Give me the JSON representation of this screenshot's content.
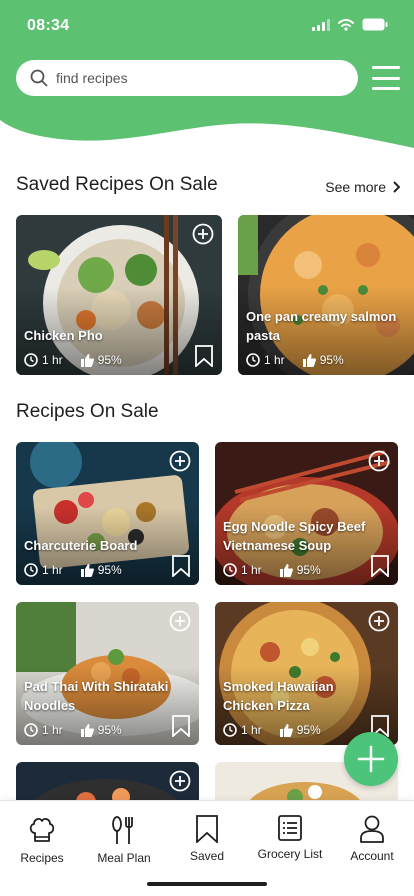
{
  "status_bar": {
    "time": "08:34"
  },
  "search": {
    "placeholder": "find recipes"
  },
  "saved_section": {
    "title": "Saved Recipes On Sale",
    "see_more": "See more"
  },
  "saved_recipes": [
    {
      "title": "Chicken Pho",
      "time": "1 hr",
      "rating": "95%"
    },
    {
      "title": "One pan creamy salmon pasta",
      "time": "1 hr",
      "rating": "95%"
    }
  ],
  "sale_section": {
    "title": "Recipes On Sale"
  },
  "sale_recipes": [
    {
      "title": "Charcuterie Board",
      "time": "1 hr",
      "rating": "95%"
    },
    {
      "title": "Egg Noodle Spicy Beef Vietnamese Soup",
      "time": "1 hr",
      "rating": "95%"
    },
    {
      "title": "Pad Thai With Shirataki Noodles",
      "time": "1 hr",
      "rating": "95%"
    },
    {
      "title": "Smoked Hawaiian Chicken Pizza",
      "time": "1 hr",
      "rating": "95%"
    }
  ],
  "nav": {
    "recipes": "Recipes",
    "meal_plan": "Meal Plan",
    "saved": "Saved",
    "grocery_list": "Grocery List",
    "account": "Account"
  },
  "colors": {
    "brand_green": "#5cc272",
    "fab_green": "#4cc47a"
  },
  "icons": [
    "search-icon",
    "menu-icon",
    "chevron-right-icon",
    "add-circle-icon",
    "clock-icon",
    "thumbs-up-icon",
    "bookmark-icon",
    "plus-icon",
    "chef-hat-icon",
    "fork-knife-icon",
    "list-icon",
    "user-icon"
  ]
}
